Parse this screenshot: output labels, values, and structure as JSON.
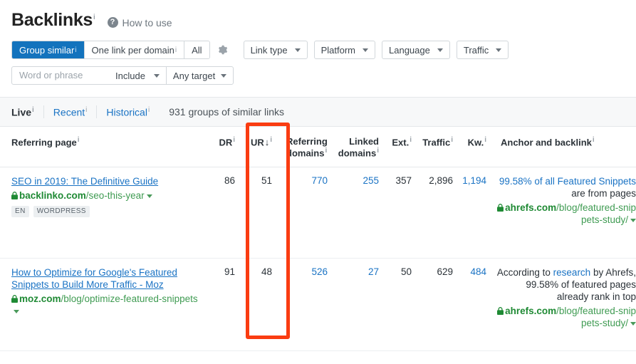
{
  "header": {
    "title": "Backlinks",
    "title_info": "i",
    "how_to_use": "How to use",
    "help_icon": "question-mark-icon"
  },
  "controls": {
    "segments": [
      {
        "label": "Group similar",
        "info": "i",
        "active": true
      },
      {
        "label": "One link per domain",
        "info": "i",
        "active": false
      },
      {
        "label": "All",
        "info": "",
        "active": false
      }
    ],
    "settings_icon": "gear-icon",
    "filters": [
      {
        "label": "Link type"
      },
      {
        "label": "Platform"
      },
      {
        "label": "Language"
      },
      {
        "label": "Traffic"
      }
    ]
  },
  "search": {
    "placeholder": "Word or phrase",
    "value": "",
    "mode": "Include",
    "target": "Any target"
  },
  "tabs": {
    "items": [
      {
        "label": "Live",
        "info": "i",
        "active": true
      },
      {
        "label": "Recent",
        "info": "i",
        "active": false
      },
      {
        "label": "Historical",
        "info": "i",
        "active": false
      }
    ],
    "count_label": "931 groups of similar links"
  },
  "table": {
    "columns": [
      {
        "label": "Referring page",
        "info": "i"
      },
      {
        "label": "DR",
        "info": "i"
      },
      {
        "label": "UR",
        "info": "i",
        "sort": "↓"
      },
      {
        "label": "Referring domains",
        "info": "i"
      },
      {
        "label": "Linked domains",
        "info": "i"
      },
      {
        "label": "Ext.",
        "info": "i"
      },
      {
        "label": "Traffic",
        "info": "i"
      },
      {
        "label": "Kw.",
        "info": "i"
      },
      {
        "label": "Anchor and backlink",
        "info": "i"
      }
    ],
    "rows": [
      {
        "title": "SEO in 2019: The Definitive Guide",
        "domain": "backlinko.com",
        "path": "/seo-this-year",
        "tags": [
          "EN",
          "WORDPRESS"
        ],
        "dr": "86",
        "ur": "51",
        "referring_domains": "770",
        "linked_domains": "255",
        "ext": "357",
        "traffic": "2,896",
        "kw": "1,194",
        "anchor_link": "99.58% of all Featured Snippets",
        "anchor_rest": " are from pages",
        "backlink_domain": "ahrefs.com",
        "backlink_path": "/blog/featured-snippets-study/"
      },
      {
        "title": "How to Optimize for Google's Featured Snippets to Build More Traffic - Moz",
        "domain": "moz.com",
        "path": "/blog/optimize-featured-snippets",
        "tags": [],
        "dr": "91",
        "ur": "48",
        "referring_domains": "526",
        "linked_domains": "27",
        "ext": "50",
        "traffic": "629",
        "kw": "484",
        "anchor_pre": "According to ",
        "anchor_link": "research",
        "anchor_rest": " by Ahrefs, 99.58% of featured pages already rank in top",
        "backlink_domain": "ahrefs.com",
        "backlink_path": "/blog/featured-snippets-study/"
      }
    ]
  },
  "annotation": {
    "highlight_color": "#fa3c11",
    "highlight_target": "ur-column"
  },
  "colors": {
    "accent_blue": "#1373bd",
    "link_blue": "#1a73c4",
    "green": "#1f8a34",
    "highlight": "#fa3c11"
  }
}
